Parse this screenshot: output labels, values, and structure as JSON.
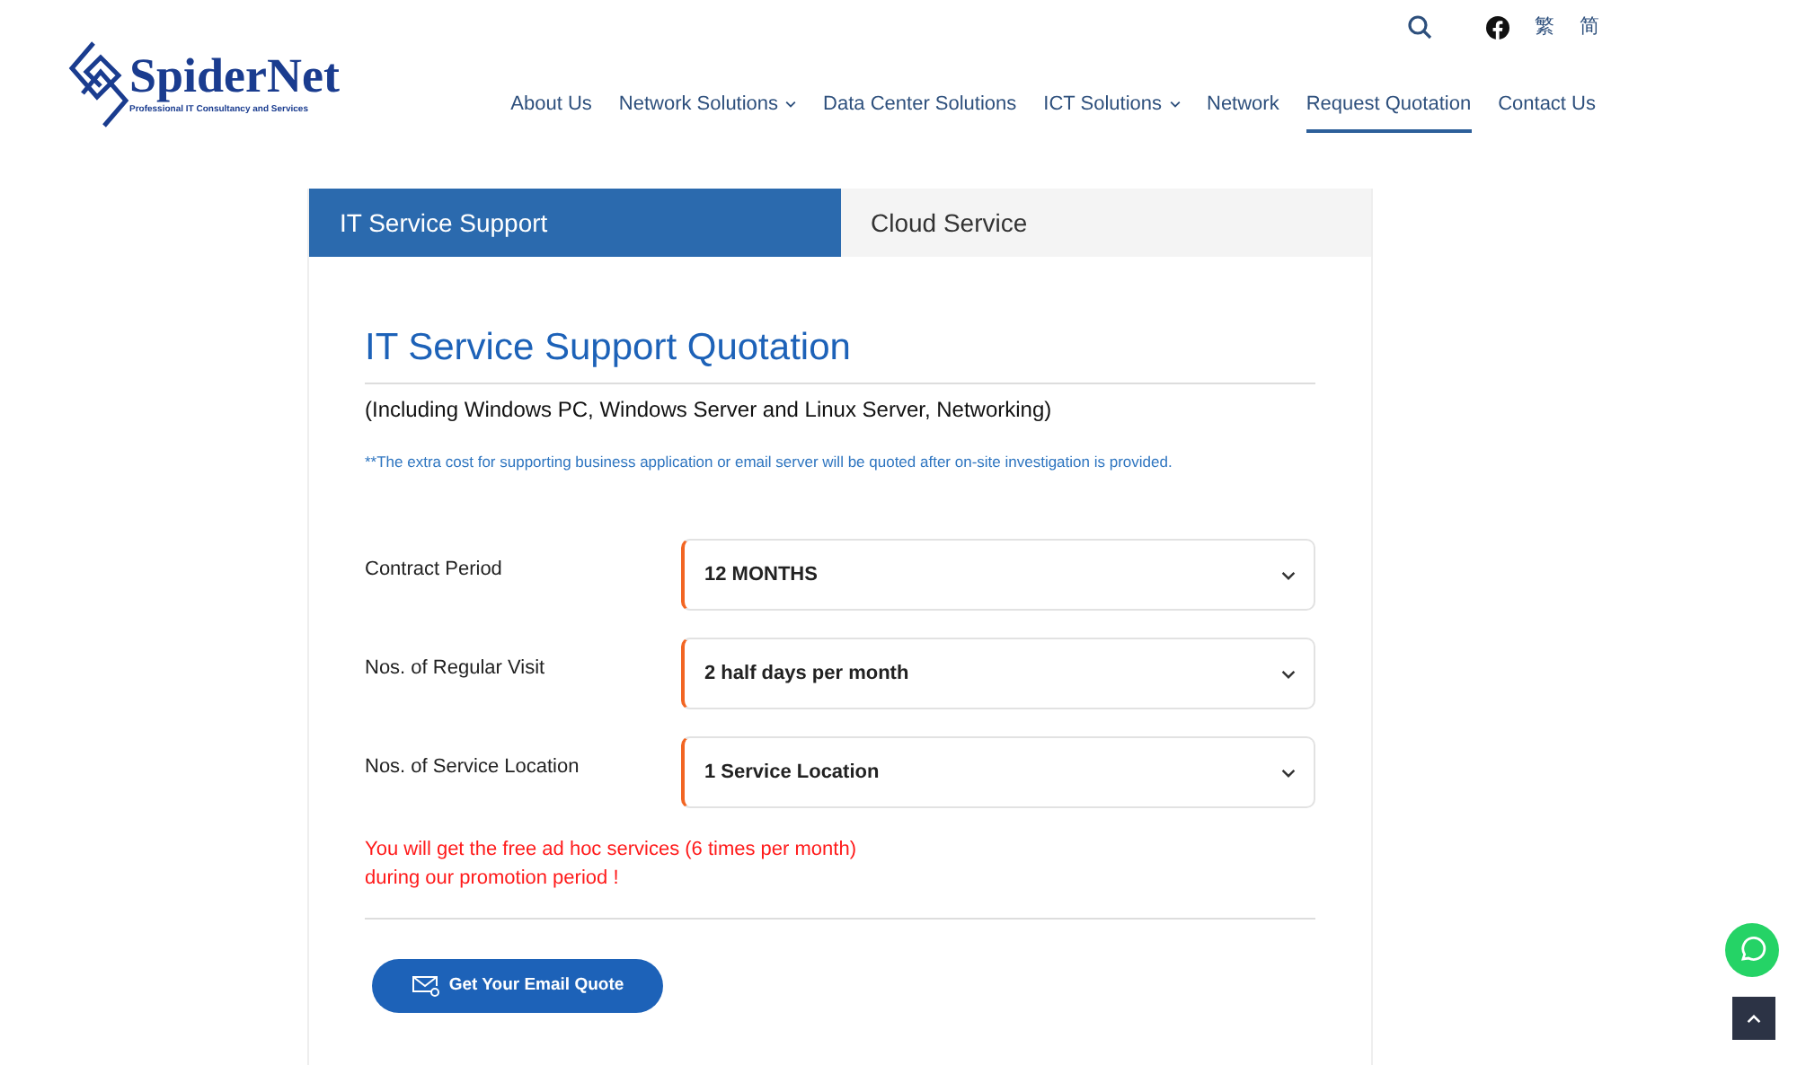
{
  "header": {
    "logo": {
      "name": "SpiderNet",
      "tagline": "Professional IT Consultancy and Services"
    },
    "utility": {
      "languages": [
        {
          "label": "繁"
        },
        {
          "label": "简"
        }
      ]
    },
    "nav": [
      {
        "label": "About Us",
        "has_menu": false,
        "selected": false
      },
      {
        "label": "Network Solutions",
        "has_menu": true,
        "selected": false
      },
      {
        "label": "Data Center Solutions",
        "has_menu": false,
        "selected": false
      },
      {
        "label": "ICT Solutions",
        "has_menu": true,
        "selected": false
      },
      {
        "label": "Network",
        "has_menu": false,
        "selected": false
      },
      {
        "label": "Request Quotation",
        "has_menu": false,
        "selected": true
      },
      {
        "label": "Contact Us",
        "has_menu": false,
        "selected": false
      }
    ]
  },
  "tabs": [
    {
      "label": "IT Service Support",
      "selected": true
    },
    {
      "label": "Cloud Service",
      "selected": false
    }
  ],
  "form": {
    "title": "IT Service Support Quotation",
    "subtitle": "(Including Windows PC, Windows Server and Linux Server, Networking)",
    "note": "**The extra cost for supporting business application or email server will be quoted after on-site investigation is provided.",
    "fields": [
      {
        "label": "Contract Period",
        "value": "12 MONTHS"
      },
      {
        "label": "Nos. of Regular Visit",
        "value": "2 half days per month"
      },
      {
        "label": "Nos. of Service Location",
        "value": "1 Service Location"
      }
    ],
    "promotion": [
      "You will get the free ad hoc services (6 times per month)",
      "during our promotion period !"
    ],
    "submit": "Get Your Email Quote"
  }
}
